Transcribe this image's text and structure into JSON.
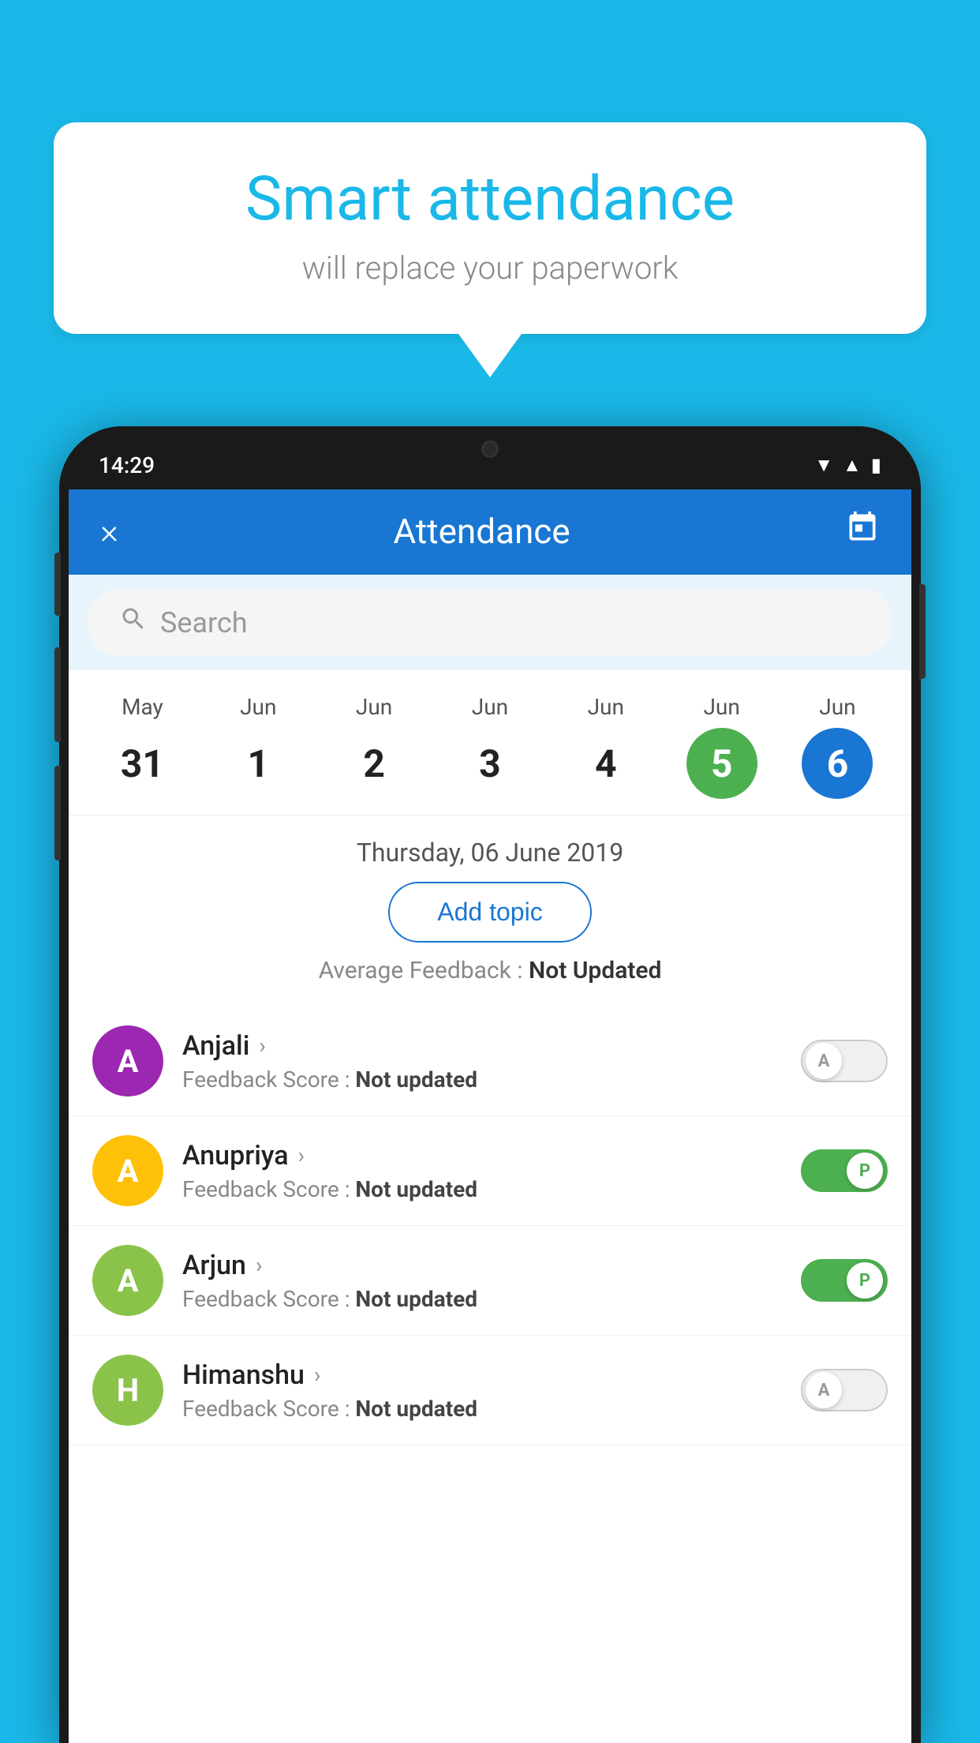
{
  "background_color": "#1ab8e8",
  "speech_bubble": {
    "title": "Smart attendance",
    "subtitle": "will replace your paperwork"
  },
  "status_bar": {
    "time": "14:29",
    "icons": [
      "wifi",
      "signal",
      "battery"
    ]
  },
  "app_header": {
    "close_label": "×",
    "title": "Attendance",
    "calendar_icon": "📅"
  },
  "search": {
    "placeholder": "Search"
  },
  "calendar": {
    "days": [
      {
        "month": "May",
        "date": "31",
        "state": "normal"
      },
      {
        "month": "Jun",
        "date": "1",
        "state": "normal"
      },
      {
        "month": "Jun",
        "date": "2",
        "state": "normal"
      },
      {
        "month": "Jun",
        "date": "3",
        "state": "normal"
      },
      {
        "month": "Jun",
        "date": "4",
        "state": "normal"
      },
      {
        "month": "Jun",
        "date": "5",
        "state": "today"
      },
      {
        "month": "Jun",
        "date": "6",
        "state": "selected"
      }
    ]
  },
  "selected_date_label": "Thursday, 06 June 2019",
  "add_topic_label": "Add topic",
  "avg_feedback_prefix": "Average Feedback : ",
  "avg_feedback_value": "Not Updated",
  "students": [
    {
      "name": "Anjali",
      "avatar_letter": "A",
      "avatar_color": "#9c27b0",
      "feedback_label": "Feedback Score : ",
      "feedback_value": "Not updated",
      "toggle_state": "off",
      "toggle_label": "A"
    },
    {
      "name": "Anupriya",
      "avatar_letter": "A",
      "avatar_color": "#ffc107",
      "feedback_label": "Feedback Score : ",
      "feedback_value": "Not updated",
      "toggle_state": "on",
      "toggle_label": "P"
    },
    {
      "name": "Arjun",
      "avatar_letter": "A",
      "avatar_color": "#8bc34a",
      "feedback_label": "Feedback Score : ",
      "feedback_value": "Not updated",
      "toggle_state": "on",
      "toggle_label": "P"
    },
    {
      "name": "Himanshu",
      "avatar_letter": "H",
      "avatar_color": "#8bc34a",
      "feedback_label": "Feedback Score : ",
      "feedback_value": "Not updated",
      "toggle_state": "off",
      "toggle_label": "A"
    }
  ]
}
